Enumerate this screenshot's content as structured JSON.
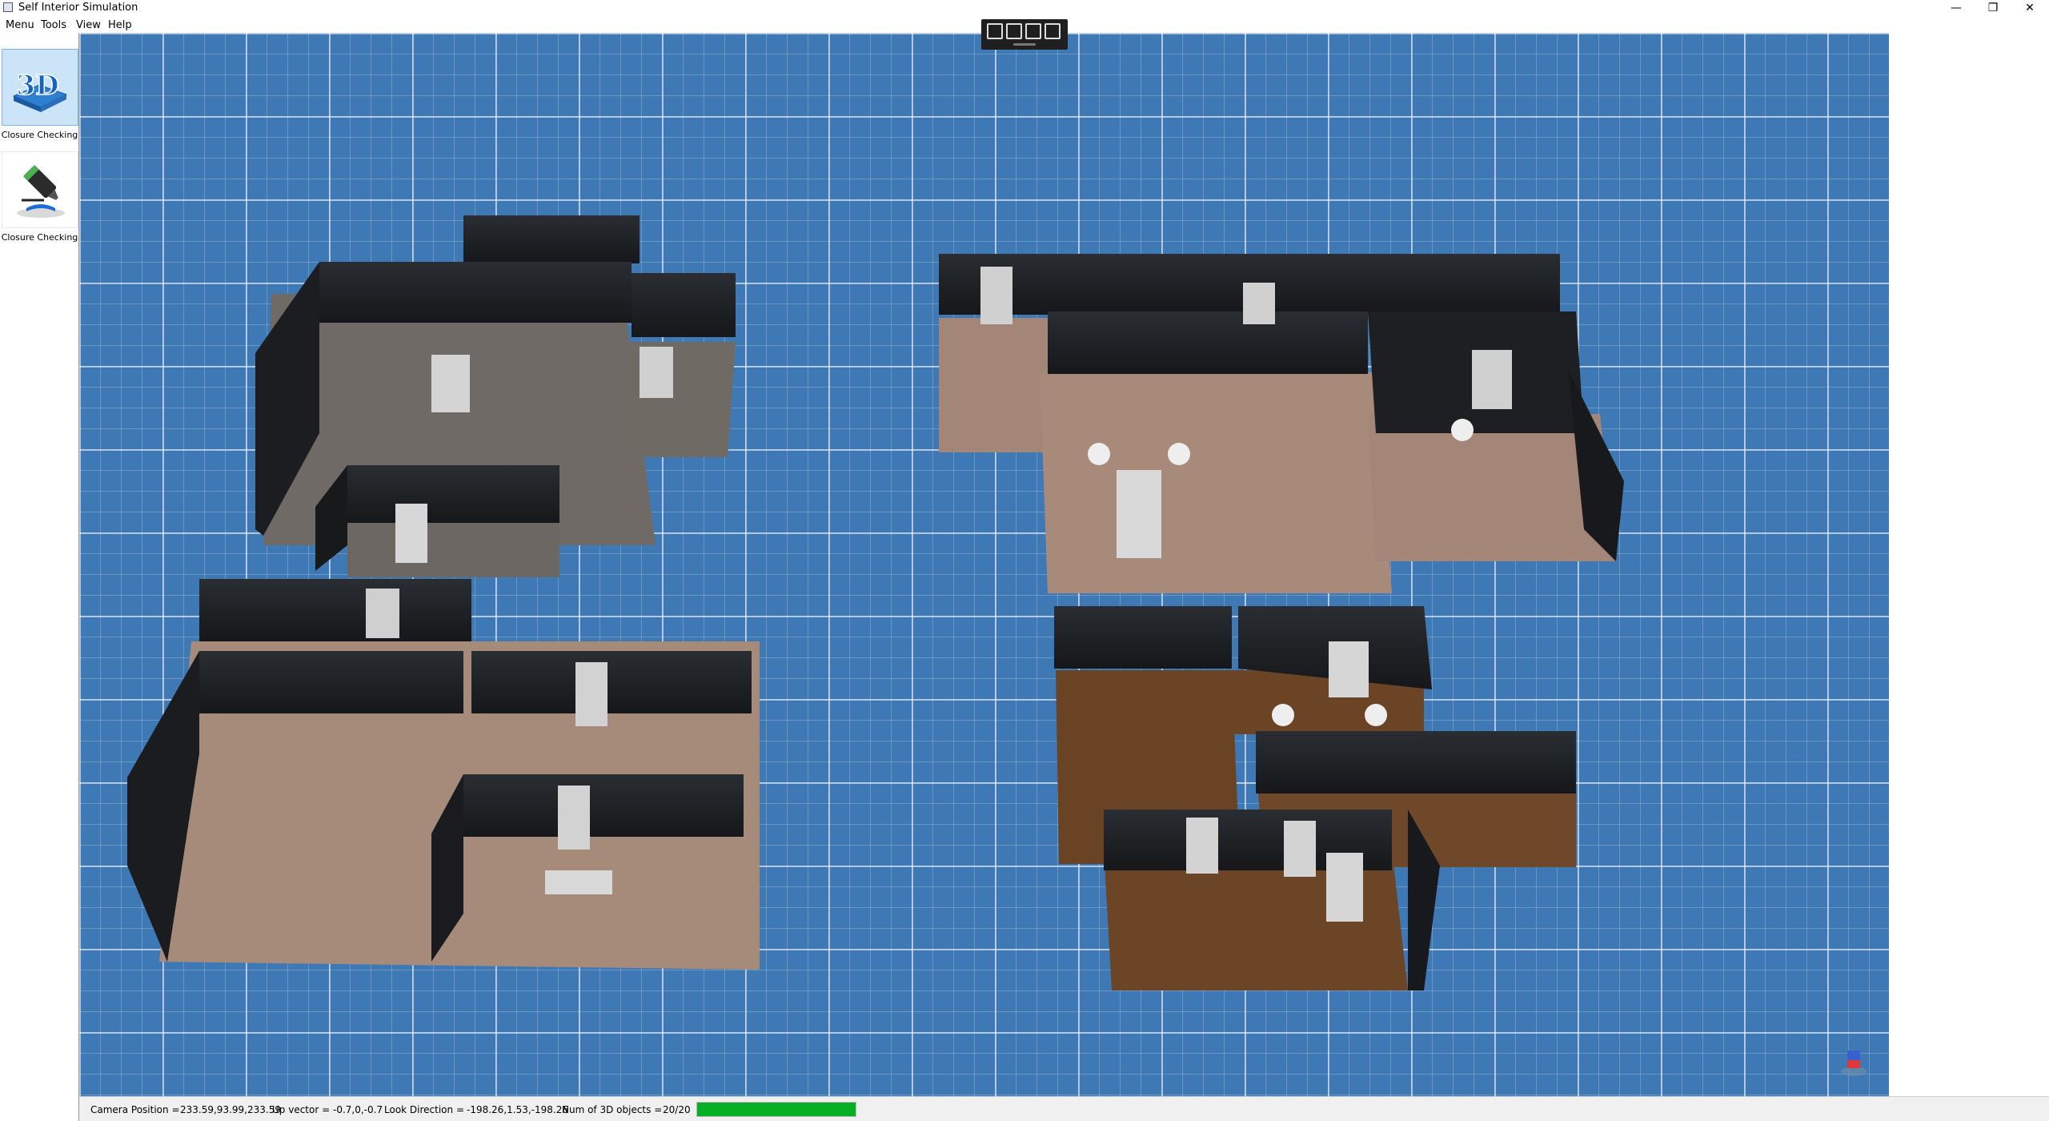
{
  "window": {
    "title": "Self Interior Simulation",
    "controls": [
      "—",
      "❐",
      "✕"
    ]
  },
  "menubar": [
    "Menu",
    "Tools",
    "View",
    "Help"
  ],
  "toolbox": [
    {
      "label": "Closure Checking",
      "icon": "3d-view-icon",
      "selected": true,
      "icon_text": "3D"
    },
    {
      "label": "Closure Checking",
      "icon": "marker-pen-icon",
      "selected": false
    }
  ],
  "floating_toolbar": {
    "icons": [
      "edit-document-icon",
      "comment-icon",
      "fit-view-icon",
      "transform-select-icon"
    ]
  },
  "status": {
    "camera_label": "Camera Position =",
    "camera_value": "233.59,93.99,233.59",
    "up_label": "Up vector =",
    "up_value": "-0.7,0,-0.7",
    "look_label": "Look Direction =",
    "look_value": "-198.26,1.53,-198.26",
    "objects_label": "Num of 3D objects =",
    "objects_value": "20/20",
    "progress": 1.0
  },
  "colors": {
    "floor_grid": "#3e78b5",
    "wall": "#1d1f22",
    "progress": "#06b025",
    "tool_selected": "#cce4f7"
  }
}
